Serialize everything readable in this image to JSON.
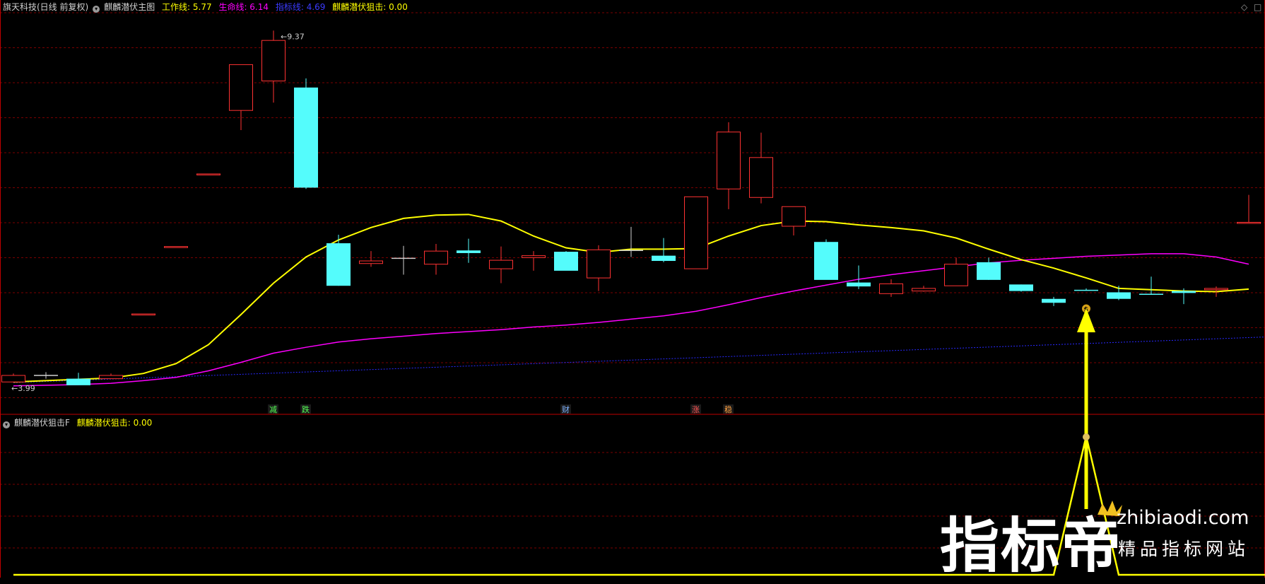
{
  "header": {
    "stock": "旗天科技(日线 前复权)",
    "main_name": "麒麟潜伏主图",
    "work_label": "工作线: 5.77",
    "life_label": "生命线: 6.14",
    "blue_label": "指标线: 4.69",
    "snipe_label": "麒麟潜伏狙击: 0.00"
  },
  "sub_header": {
    "name": "麒麟潜伏狙击F",
    "snipe_label": "麒麟潜伏狙击: 0.00"
  },
  "corner": {
    "diamond": "◇",
    "square": "□"
  },
  "watermark": {
    "big": "指标帝",
    "url": "zhibiaodi.com",
    "sub": "精品指标网站"
  },
  "colors": {
    "up": "#ff3232",
    "down": "#54fcfc",
    "work": "#ffff00",
    "life": "#ff00ff",
    "blue": "#2828ff",
    "grid": "#7a0000",
    "arrow": "#ffff00"
  },
  "chart_data": {
    "type": "candlestick",
    "y_price_range": [
      3.7,
      9.6
    ],
    "annotations": [
      {
        "text": "9.37",
        "at_index": 8
      },
      {
        "text": "3.99",
        "at_index": 0
      }
    ],
    "candles": [
      {
        "o": 4.1,
        "h": 4.13,
        "l": 3.99,
        "c": 4.0,
        "dir": "up"
      },
      {
        "o": 4.1,
        "h": 4.15,
        "l": 4.05,
        "c": 4.1,
        "dir": "flat"
      },
      {
        "o": 4.05,
        "h": 4.14,
        "l": 3.98,
        "c": 3.95,
        "dir": "down"
      },
      {
        "o": 4.05,
        "h": 4.13,
        "l": 4.05,
        "c": 4.1,
        "dir": "up"
      },
      {
        "o": 5.04,
        "h": 5.04,
        "l": 5.04,
        "c": 5.04,
        "dir": "up"
      },
      {
        "o": 6.07,
        "h": 6.07,
        "l": 6.07,
        "c": 6.07,
        "dir": "up"
      },
      {
        "o": 7.18,
        "h": 7.18,
        "l": 7.18,
        "c": 7.18,
        "dir": "up"
      },
      {
        "o": 8.15,
        "h": 8.85,
        "l": 7.85,
        "c": 8.85,
        "dir": "up"
      },
      {
        "o": 8.6,
        "h": 9.37,
        "l": 8.27,
        "c": 9.22,
        "dir": "up"
      },
      {
        "o": 8.5,
        "h": 8.64,
        "l": 6.95,
        "c": 6.97,
        "dir": "down"
      },
      {
        "o": 6.12,
        "h": 6.25,
        "l": 5.47,
        "c": 5.47,
        "dir": "down"
      },
      {
        "o": 5.85,
        "h": 6.0,
        "l": 5.76,
        "c": 5.81,
        "dir": "up"
      },
      {
        "o": 5.89,
        "h": 6.08,
        "l": 5.64,
        "c": 5.89,
        "dir": "flat"
      },
      {
        "o": 5.8,
        "h": 6.11,
        "l": 5.64,
        "c": 6.0,
        "dir": "up"
      },
      {
        "o": 6.01,
        "h": 6.19,
        "l": 5.82,
        "c": 5.97,
        "dir": "down"
      },
      {
        "o": 5.73,
        "h": 6.07,
        "l": 5.51,
        "c": 5.86,
        "dir": "up"
      },
      {
        "o": 5.9,
        "h": 6.0,
        "l": 5.7,
        "c": 5.93,
        "dir": "up"
      },
      {
        "o": 5.99,
        "h": 6.0,
        "l": 5.71,
        "c": 5.7,
        "dir": "down"
      },
      {
        "o": 5.59,
        "h": 6.09,
        "l": 5.39,
        "c": 6.02,
        "dir": "up"
      },
      {
        "o": 6.01,
        "h": 6.37,
        "l": 5.91,
        "c": 6.0,
        "dir": "flat"
      },
      {
        "o": 5.93,
        "h": 6.2,
        "l": 5.83,
        "c": 5.85,
        "dir": "down"
      },
      {
        "o": 5.73,
        "h": 6.83,
        "l": 5.73,
        "c": 6.83,
        "dir": "up"
      },
      {
        "o": 6.95,
        "h": 7.97,
        "l": 6.64,
        "c": 7.82,
        "dir": "up"
      },
      {
        "o": 6.82,
        "h": 7.81,
        "l": 6.73,
        "c": 7.43,
        "dir": "up"
      },
      {
        "o": 6.38,
        "h": 6.68,
        "l": 6.24,
        "c": 6.68,
        "dir": "up"
      },
      {
        "o": 6.14,
        "h": 6.18,
        "l": 5.58,
        "c": 5.56,
        "dir": "down"
      },
      {
        "o": 5.52,
        "h": 5.78,
        "l": 5.42,
        "c": 5.46,
        "dir": "down"
      },
      {
        "o": 5.35,
        "h": 5.57,
        "l": 5.3,
        "c": 5.5,
        "dir": "up"
      },
      {
        "o": 5.39,
        "h": 5.47,
        "l": 5.38,
        "c": 5.43,
        "dir": "up"
      },
      {
        "o": 5.47,
        "h": 5.9,
        "l": 5.47,
        "c": 5.8,
        "dir": "up"
      },
      {
        "o": 5.83,
        "h": 5.9,
        "l": 5.56,
        "c": 5.56,
        "dir": "down"
      },
      {
        "o": 5.49,
        "h": 5.49,
        "l": 5.38,
        "c": 5.39,
        "dir": "down"
      },
      {
        "o": 5.27,
        "h": 5.3,
        "l": 5.16,
        "c": 5.21,
        "dir": "down"
      },
      {
        "o": 5.4,
        "h": 5.43,
        "l": 5.4,
        "c": 5.4,
        "dir": "flat"
      },
      {
        "o": 5.37,
        "h": 5.47,
        "l": 5.25,
        "c": 5.27,
        "dir": "down"
      },
      {
        "o": 5.34,
        "h": 5.61,
        "l": 5.34,
        "c": 5.34,
        "dir": "flat"
      },
      {
        "o": 5.39,
        "h": 5.43,
        "l": 5.19,
        "c": 5.36,
        "dir": "down"
      },
      {
        "o": 5.41,
        "h": 5.46,
        "l": 5.3,
        "c": 5.43,
        "dir": "up"
      },
      {
        "o": 6.44,
        "h": 6.86,
        "l": 6.44,
        "c": 6.44,
        "dir": "up"
      }
    ],
    "work_line": [
      4.0,
      4.02,
      4.04,
      4.06,
      4.13,
      4.28,
      4.57,
      5.03,
      5.51,
      5.91,
      6.17,
      6.36,
      6.5,
      6.55,
      6.56,
      6.46,
      6.23,
      6.05,
      5.98,
      6.03,
      6.03,
      6.04,
      6.23,
      6.39,
      6.46,
      6.45,
      6.4,
      6.36,
      6.31,
      6.2,
      6.03,
      5.87,
      5.74,
      5.59,
      5.43,
      5.41,
      5.39,
      5.38,
      5.42
    ],
    "life_line": [
      3.94,
      3.95,
      3.96,
      3.98,
      4.02,
      4.07,
      4.17,
      4.3,
      4.44,
      4.53,
      4.61,
      4.66,
      4.7,
      4.74,
      4.77,
      4.8,
      4.84,
      4.87,
      4.91,
      4.96,
      5.01,
      5.08,
      5.18,
      5.29,
      5.39,
      5.48,
      5.57,
      5.64,
      5.7,
      5.76,
      5.82,
      5.86,
      5.89,
      5.92,
      5.94,
      5.96,
      5.96,
      5.91,
      5.8
    ],
    "blue_line_range": [
      3.99,
      4.69
    ],
    "signals": [
      {
        "text": "减",
        "at_index": 8,
        "color": "#54ff54"
      },
      {
        "text": "跌",
        "at_index": 9,
        "color": "#54ff54"
      },
      {
        "text": "财",
        "at_index": 17,
        "color": "#7fb2ff"
      },
      {
        "text": "涨",
        "at_index": 21,
        "color": "#ff5454"
      },
      {
        "text": "稳",
        "at_index": 22,
        "color": "#ffa040"
      }
    ],
    "buy_marker": {
      "text": "$",
      "at_index": 33
    },
    "sub_indicator": {
      "name": "麒麟潜伏狙击",
      "peak_index": 33,
      "peak_value": 1,
      "baseline": 0
    }
  }
}
